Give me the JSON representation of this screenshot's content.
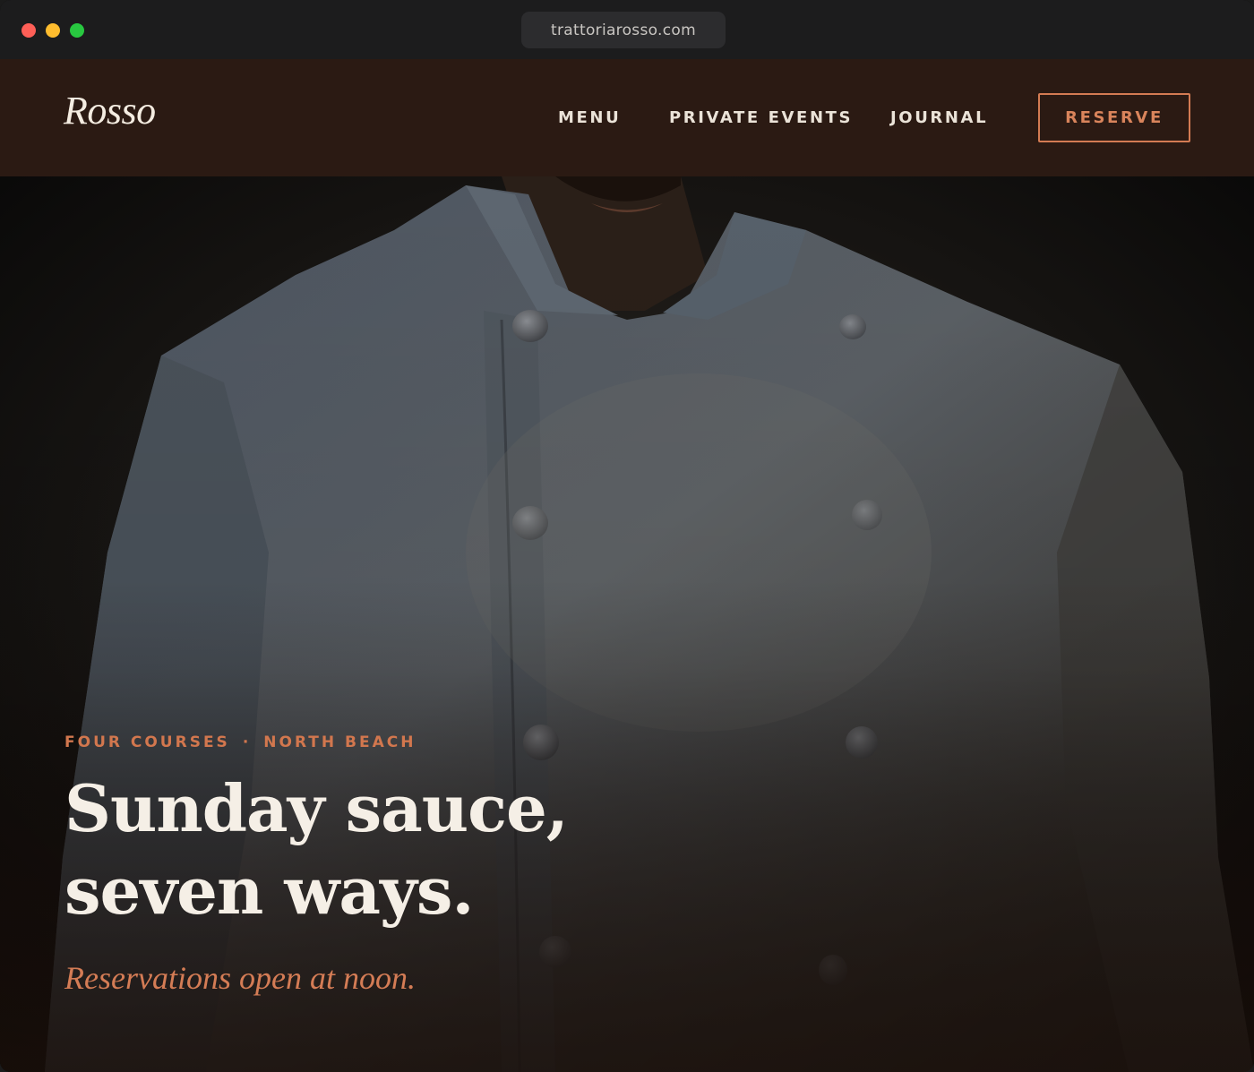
{
  "browser": {
    "url": "trattoriarosso.com"
  },
  "header": {
    "logo": "Rosso",
    "nav": {
      "menu": "MENU",
      "private_events": "PRIVATE EVENTS",
      "journal": "JOURNAL"
    },
    "reserve_label": "RESERVE"
  },
  "hero": {
    "eyebrow_left": "FOUR COURSES",
    "eyebrow_separator": "·",
    "eyebrow_right": "NORTH BEACH",
    "headline_line1": "Sunday sauce,",
    "headline_line2": "seven ways.",
    "subline": "Reservations open at noon."
  },
  "colors": {
    "header_bg": "#2b1a13",
    "accent": "#d47b53",
    "headline": "#f5efe6"
  }
}
